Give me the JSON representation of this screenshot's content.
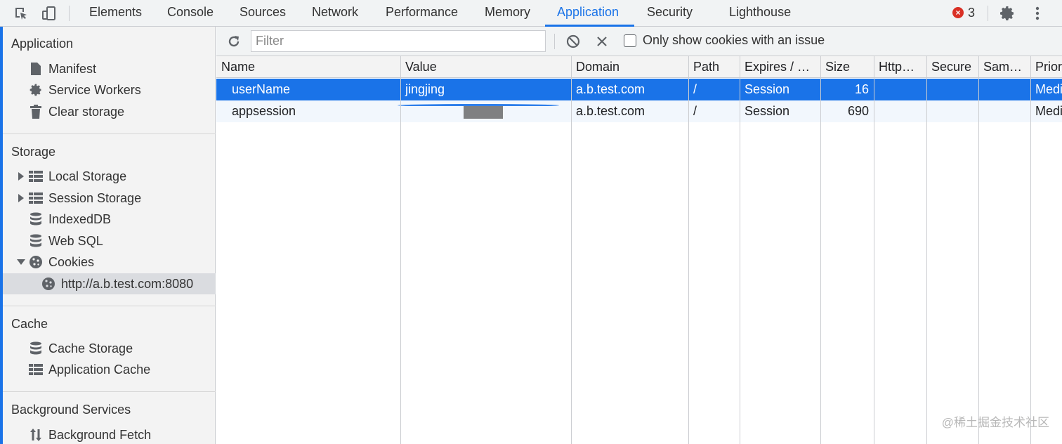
{
  "tabs": [
    {
      "label": "Elements"
    },
    {
      "label": "Console"
    },
    {
      "label": "Sources"
    },
    {
      "label": "Network"
    },
    {
      "label": "Performance"
    },
    {
      "label": "Memory"
    },
    {
      "label": "Application",
      "active": true
    },
    {
      "label": "Security"
    },
    {
      "label": "Lighthouse"
    }
  ],
  "errors": {
    "count": "3"
  },
  "sidebar": {
    "application": {
      "title": "Application",
      "items": [
        {
          "label": "Manifest",
          "icon": "document-icon"
        },
        {
          "label": "Service Workers",
          "icon": "gear-icon"
        },
        {
          "label": "Clear storage",
          "icon": "trash-icon"
        }
      ]
    },
    "storage": {
      "title": "Storage",
      "items": [
        {
          "label": "Local Storage",
          "icon": "table-icon"
        },
        {
          "label": "Session Storage",
          "icon": "table-icon"
        },
        {
          "label": "IndexedDB",
          "icon": "database-icon"
        },
        {
          "label": "Web SQL",
          "icon": "database-icon"
        },
        {
          "label": "Cookies",
          "icon": "cookie-icon"
        },
        {
          "label": "http://a.b.test.com:8080",
          "icon": "cookie-icon"
        }
      ]
    },
    "cache": {
      "title": "Cache",
      "items": [
        {
          "label": "Cache Storage",
          "icon": "database-icon"
        },
        {
          "label": "Application Cache",
          "icon": "table-icon"
        }
      ]
    },
    "background": {
      "title": "Background Services",
      "items": [
        {
          "label": "Background Fetch",
          "icon": "updown-arrows-icon"
        }
      ]
    }
  },
  "toolbar": {
    "filter_placeholder": "Filter",
    "issue_checkbox_label": "Only show cookies with an issue"
  },
  "cookies_table": {
    "columns": [
      "Name",
      "Value",
      "Domain",
      "Path",
      "Expires / …",
      "Size",
      "Http…",
      "Secure",
      "Sam…",
      "Prior"
    ],
    "rows": [
      {
        "name": "userName",
        "value": "jingjing",
        "domain": "a.b.test.com",
        "path": "/",
        "expires": "Session",
        "size": "16",
        "priority": "Medi"
      },
      {
        "name": "appsession",
        "value": "",
        "domain": "a.b.test.com",
        "path": "/",
        "expires": "Session",
        "size": "690",
        "priority": "Medi"
      }
    ]
  },
  "watermark": "@稀土掘金技术社区",
  "colors": {
    "accent": "#1a73e8",
    "error": "#d93025"
  }
}
